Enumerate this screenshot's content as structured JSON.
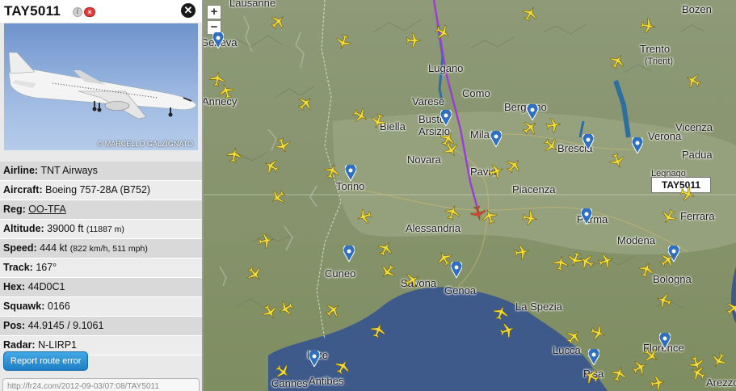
{
  "panel": {
    "flight_id": "TAY5011",
    "photo_credit": "© MARCELLO GALZIGNATO",
    "rows": [
      {
        "label": "Airline:",
        "value": "TNT Airways"
      },
      {
        "label": "Aircraft:",
        "value": "Boeing 757-28A (B752)"
      },
      {
        "label": "Reg:",
        "value": "OO-TFA"
      },
      {
        "label": "Altitude:",
        "value": "39000 ft",
        "sub": "(11887 m)"
      },
      {
        "label": "Speed:",
        "value": "444 kt",
        "sub": "(822 km/h, 511 mph)"
      },
      {
        "label": "Track:",
        "value": "167°"
      },
      {
        "label": "Hex:",
        "value": "44D0C1"
      },
      {
        "label": "Squawk:",
        "value": "0166"
      },
      {
        "label": "Pos:",
        "value": "44.9145 / 9.1061"
      },
      {
        "label": "Radar:",
        "value": "N-LIRP1"
      }
    ],
    "route_button": "Report route error",
    "link_value": "http://fr24.com/2012-09-03/07:08/TAY5011"
  },
  "map": {
    "zoom_in": "+",
    "zoom_out": "−",
    "selected_flight_label": "TAY5011",
    "colors": {
      "sea": "#3e5a8a",
      "land": "#7c8a5e",
      "track": "#9b3fd0",
      "plane": "#f2dc3a",
      "selected_plane": "#d94040",
      "radar_pin": "#2f6fbf"
    },
    "cities": [
      {
        "name": "Lausanne"
      },
      {
        "name": "Lugano"
      },
      {
        "name": "Varese"
      },
      {
        "name": "Como"
      },
      {
        "name": "Bergamo"
      },
      {
        "name": "Busto Arsizio"
      },
      {
        "name": "Biella"
      },
      {
        "name": "Milan"
      },
      {
        "name": "Brescia"
      },
      {
        "name": "Verona"
      },
      {
        "name": "Vicenza"
      },
      {
        "name": "Padua"
      },
      {
        "name": "Novara"
      },
      {
        "name": "Torino"
      },
      {
        "name": "Pavia"
      },
      {
        "name": "Piacenza"
      },
      {
        "name": "Legnago"
      },
      {
        "name": "Alessandria"
      },
      {
        "name": "Parma"
      },
      {
        "name": "Ferrara"
      },
      {
        "name": "Modena"
      },
      {
        "name": "Cuneo"
      },
      {
        "name": "Savona"
      },
      {
        "name": "Genoa"
      },
      {
        "name": "Bologna"
      },
      {
        "name": "La Spezia"
      },
      {
        "name": "Lucca"
      },
      {
        "name": "Nice"
      },
      {
        "name": "Antibes"
      },
      {
        "name": "Cannes"
      },
      {
        "name": "Pisa"
      },
      {
        "name": "Florence"
      },
      {
        "name": "Arezzo"
      },
      {
        "name": "Trento"
      },
      {
        "name": "(Trient)"
      },
      {
        "name": "Annecy"
      },
      {
        "name": "Geneva"
      },
      {
        "name": "Bozen"
      }
    ]
  }
}
